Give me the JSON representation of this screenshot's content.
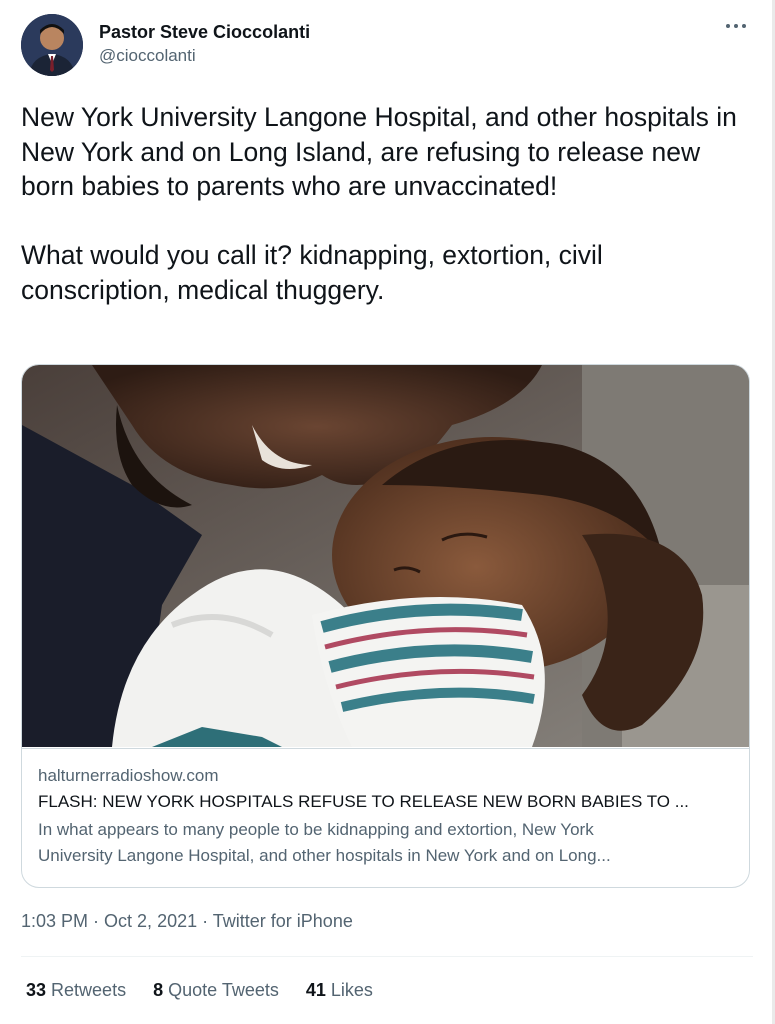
{
  "author": {
    "name": "Pastor Steve Cioccolanti",
    "handle": "@cioccolanti",
    "avatar_icon": "avatar-photo"
  },
  "more_icon": "more-options-icon",
  "tweet_text": "New York University Langone Hospital, and other hospitals in New York and on Long Island, are refusing to release new born babies to parents who are unvaccinated!\n\nWhat would you call it? kidnapping, extortion, civil conscription, medical thuggery.",
  "card": {
    "domain": "halturnerradioshow.com",
    "title": "FLASH: NEW YORK HOSPITALS REFUSE TO RELEASE NEW BORN BABIES TO ...",
    "description_line1": "In what appears to many people to be kidnapping and extortion, New York",
    "description_line2": "University Langone Hospital, and other hospitals in New York and on Long..."
  },
  "meta": {
    "time": "1:03 PM",
    "separator1": " · ",
    "date": "Oct 2, 2021",
    "separator2": " · ",
    "source": "Twitter for iPhone"
  },
  "stats": {
    "retweets_count": "33",
    "retweets_label": " Retweets",
    "quotes_count": "8",
    "quotes_label": " Quote Tweets",
    "likes_count": "41",
    "likes_label": " Likes"
  },
  "colors": {
    "text": "#0f1419",
    "secondary": "#536471",
    "border": "#cfd9de"
  }
}
